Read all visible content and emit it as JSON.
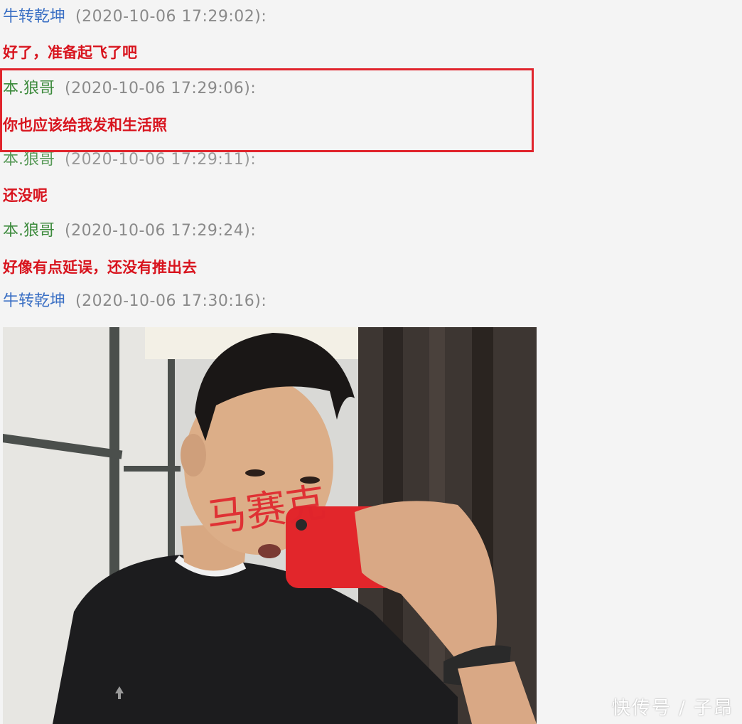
{
  "colors": {
    "sender_blue": "#3a6fc4",
    "sender_green": "#3c8a3c",
    "timestamp_gray": "#8a8a8a",
    "message_red": "#d8141e",
    "highlight_border": "#e0242c"
  },
  "messages": [
    {
      "sender": "牛转乾坤",
      "time": "(2020-10-06 17:29:02):",
      "text": "好了，准备起飞了吧"
    },
    {
      "sender": "本.狼哥",
      "time": "(2020-10-06 17:29:06):",
      "text": "你也应该给我发和生活照"
    },
    {
      "sender": "本.狼哥",
      "time": "(2020-10-06 17:29:11):",
      "text": "还没呢"
    },
    {
      "sender": "本.狼哥",
      "time": "(2020-10-06 17:29:24):",
      "text": "好像有点延误，还没有推出去"
    },
    {
      "sender": "牛转乾坤",
      "time": "(2020-10-06 17:30:16):",
      "text": ""
    }
  ],
  "photo": {
    "overlay_scribble": "马赛克",
    "description_icon": "mirror-selfie-photo"
  },
  "watermark": "快传号 / 子昂"
}
